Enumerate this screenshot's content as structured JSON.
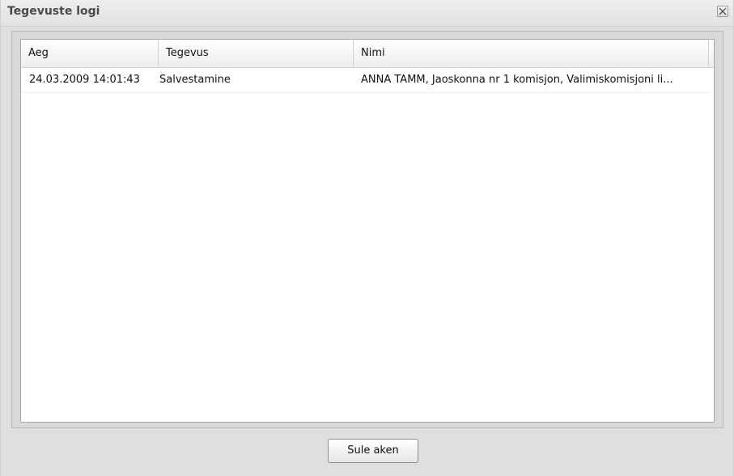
{
  "dialog": {
    "title": "Tegevuste logi",
    "close_icon": "close-icon"
  },
  "grid": {
    "columns": [
      "Aeg",
      "Tegevus",
      "Nimi"
    ],
    "rows": [
      {
        "time": "24.03.2009 14:01:43",
        "action": "Salvestamine",
        "name": "ANNA TAMM, Jaoskonna nr 1 komisjon, Valimiskomisjoni li..."
      }
    ]
  },
  "footer": {
    "close_label": "Sule aken"
  }
}
